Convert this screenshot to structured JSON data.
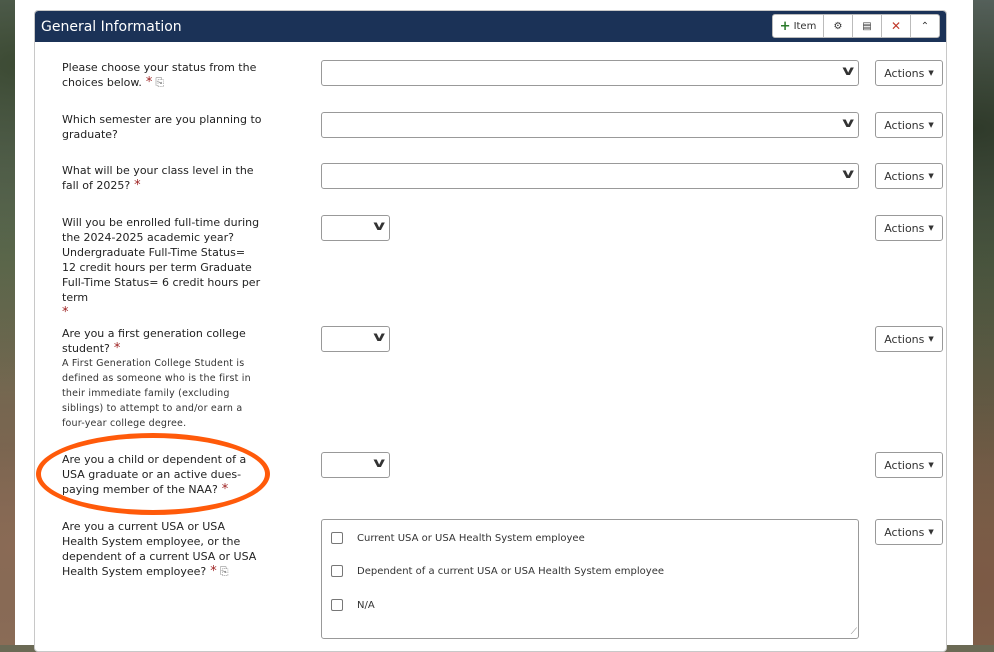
{
  "panel": {
    "title": "General Information",
    "buttons": {
      "item_label": "Item"
    }
  },
  "actions_label": "Actions",
  "required_mark": "*",
  "questions": [
    {
      "label": "Please choose your status from the choices below.",
      "value": ""
    },
    {
      "label": "Which semester are you planning to graduate?",
      "value": ""
    },
    {
      "label": "What will be your class level in the fall of 2025?",
      "value": ""
    },
    {
      "label": "Will you be enrolled full-time during the 2024-2025 academic year? Undergraduate Full-Time Status= 12 credit hours per term Graduate Full-Time Status= 6 credit hours per term",
      "value": ""
    },
    {
      "label": "Are you a first generation college student?",
      "help": "A First Generation College Student is defined as someone who is the first in their immediate family (excluding siblings) to attempt to and/or earn a four-year college degree.",
      "value": ""
    },
    {
      "label": "Are you a child or dependent of a USA graduate or an active dues-paying member of the NAA?",
      "value": ""
    },
    {
      "label": "Are you a current USA or USA Health System employee, or the dependent of a current USA or USA Health System employee?",
      "options": [
        "Current USA or USA Health System employee",
        "Dependent of a current USA or USA Health System employee",
        "N/A"
      ]
    }
  ],
  "colors": {
    "header": "#1b3257",
    "required": "#9b1c1c",
    "annotation": "#ff5a0a"
  }
}
